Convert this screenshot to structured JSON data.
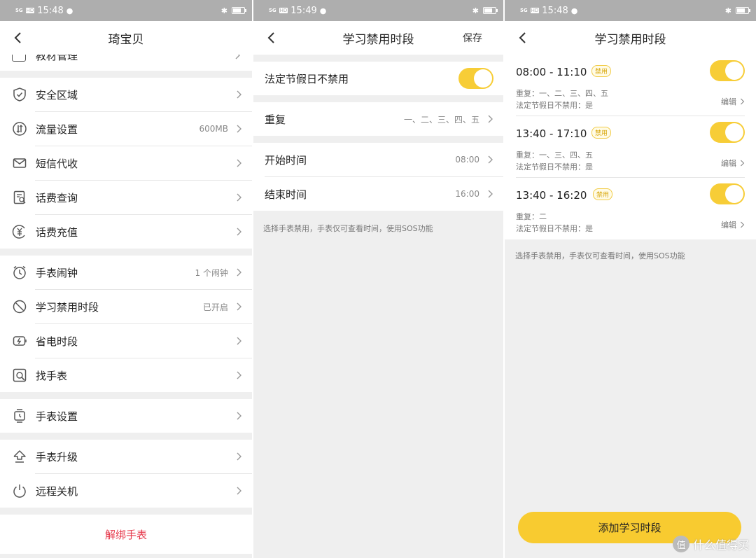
{
  "status_bars": [
    {
      "network": "5G",
      "hd": "HD",
      "time": "15:48"
    },
    {
      "network": "5G",
      "hd": "HD",
      "time": "15:49"
    },
    {
      "network": "5G",
      "hd": "HD",
      "time": "15:48"
    }
  ],
  "panel1": {
    "title": "琦宝贝",
    "partial_item": "教材管理",
    "group1": [
      {
        "label": "安全区域",
        "value": "",
        "icon": "shield-icon"
      },
      {
        "label": "流量设置",
        "value": "600MB",
        "icon": "data-flow-icon"
      },
      {
        "label": "短信代收",
        "value": "",
        "icon": "envelope-icon"
      },
      {
        "label": "话费查询",
        "value": "",
        "icon": "bill-search-icon"
      },
      {
        "label": "话费充值",
        "value": "",
        "icon": "yuan-coin-icon"
      }
    ],
    "group2": [
      {
        "label": "手表闹钟",
        "value": "1 个闹钟",
        "icon": "alarm-clock-icon"
      },
      {
        "label": "学习禁用时段",
        "value": "已开启",
        "icon": "forbidden-icon"
      },
      {
        "label": "省电时段",
        "value": "",
        "icon": "battery-bolt-icon"
      },
      {
        "label": "找手表",
        "value": "",
        "icon": "find-watch-icon"
      }
    ],
    "group3": [
      {
        "label": "手表设置",
        "value": "",
        "icon": "watch-settings-icon"
      }
    ],
    "group4": [
      {
        "label": "手表升级",
        "value": "",
        "icon": "upgrade-icon"
      },
      {
        "label": "远程关机",
        "value": "",
        "icon": "power-icon"
      }
    ],
    "unbind": "解绑手表"
  },
  "panel2": {
    "title": "学习禁用时段",
    "save": "保存",
    "holiday_label": "法定节假日不禁用",
    "holiday_on": true,
    "repeat_label": "重复",
    "repeat_value": "一、二、三、四、五",
    "start_label": "开始时间",
    "start_value": "08:00",
    "end_label": "结束时间",
    "end_value": "16:00",
    "hint": "选择手表禁用，手表仅可查看时间，使用SOS功能"
  },
  "panel3": {
    "title": "学习禁用时段",
    "badge": "禁用",
    "edit": "编辑",
    "periods": [
      {
        "time": "08:00 - 11:10",
        "repeat": "重复：一、二、三、四、五",
        "holiday": "法定节假日不禁用：是",
        "on": true
      },
      {
        "time": "13:40 - 17:10",
        "repeat": "重复：一、三、四、五",
        "holiday": "法定节假日不禁用：是",
        "on": true
      },
      {
        "time": "13:40 - 16:20",
        "repeat": "重复：二",
        "holiday": "法定节假日不禁用：是",
        "on": true
      }
    ],
    "hint": "选择手表禁用，手表仅可查看时间，使用SOS功能",
    "add_button": "添加学习时段"
  },
  "watermark": {
    "logo": "值",
    "text": "什么值得买"
  },
  "colors": {
    "accent_yellow": "#f8cb30",
    "danger_red": "#e6374a",
    "status_gray": "#aeaeae"
  }
}
